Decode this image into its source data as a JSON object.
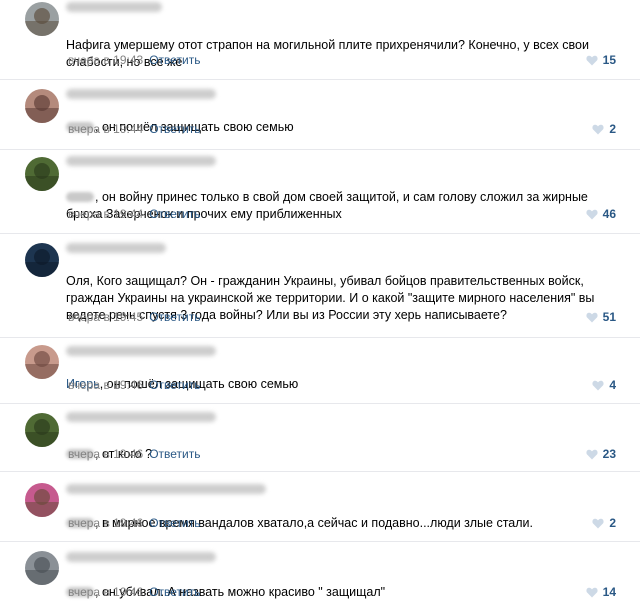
{
  "reply_label": "Ответить",
  "comments": [
    {
      "avatar_colors": [
        "#9aa0a2",
        "#5a4c3c"
      ],
      "time": "вчера в 19:43",
      "text": "Нафига умершему отот страпон на могильной плите прихренячили? Конечно, у всех свои слабости, но все же",
      "mention": "",
      "likes": "15"
    },
    {
      "avatar_colors": [
        "#b48a7c",
        "#5a3a34"
      ],
      "time": "вчера в 19:44",
      "text": ", он пошёл защищать свою семью",
      "mention": "Игорь",
      "likes": "2"
    },
    {
      "avatar_colors": [
        "#4f6a34",
        "#2b3a1c"
      ],
      "time": "вчера в 19:44",
      "text": ", он войну принес только в свой дом своей защитой, и сам голову сложил за жирные брюха Захерченок и прочих ему приближенных",
      "mention": "",
      "likes": "46"
    },
    {
      "avatar_colors": [
        "#1d3550",
        "#0c1a2a"
      ],
      "time": "вчера в 19:45",
      "text": "Оля, Кого защищал? Он - гражданин Украины, убивал бойцов правительственных войск, граждан Украины на украинской же территории. И о какой \"защите мирного населения\" вы ведете речь спустя 3 года войны? Или вы из России эту херь написываете?",
      "mention": "",
      "likes": "51"
    },
    {
      "avatar_colors": [
        "#c89a8c",
        "#6e4840"
      ],
      "time": "вчера в 19:46",
      "text": ", он пошёл защищать свою семью",
      "mention": "Игорь",
      "likes": "4"
    },
    {
      "avatar_colors": [
        "#4f6a34",
        "#2b3a1c"
      ],
      "time": "вчера в 19:46",
      "text": ", от кого ?",
      "mention": "",
      "likes": "23"
    },
    {
      "avatar_colors": [
        "#c65a8e",
        "#6a4a3a"
      ],
      "time": "вчера в 19:46",
      "text": ", в мирное время вандалов хватало,а сейчас и подавно...люди злые стали.",
      "mention": "",
      "likes": "2"
    },
    {
      "avatar_colors": [
        "#8a9096",
        "#4a5056"
      ],
      "time": "вчера в 19:46",
      "text": ", он убивал. А назвать можно красиво \" защищал\"",
      "mention": "",
      "likes": "14"
    }
  ]
}
